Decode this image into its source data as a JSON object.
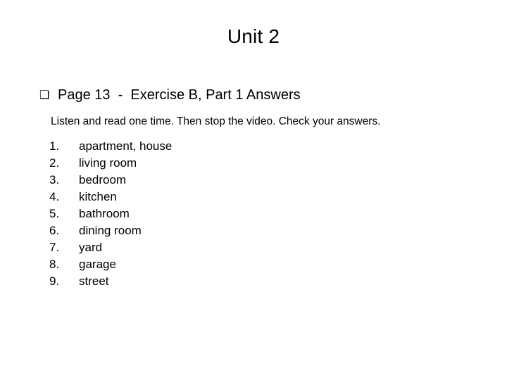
{
  "slide": {
    "title": "Unit 2",
    "heading": {
      "bullet_glyph": "❑",
      "bullet_icon_name": "square-bullet-icon",
      "text": "Page 13  -  Exercise B, Part 1 Answers"
    },
    "instruction": "Listen and read one time. Then stop the video. Check your answers.",
    "answers": [
      {
        "number": "1.",
        "text": "apartment, house"
      },
      {
        "number": "2.",
        "text": "living room"
      },
      {
        "number": "3.",
        "text": "bedroom"
      },
      {
        "number": "4.",
        "text": "kitchen"
      },
      {
        "number": "5.",
        "text": "bathroom"
      },
      {
        "number": "6.",
        "text": "dining room"
      },
      {
        "number": "7.",
        "text": "yard"
      },
      {
        "number": "8.",
        "text": "garage"
      },
      {
        "number": "9.",
        "text": "street"
      }
    ]
  },
  "colors": {
    "background": "#ffffff",
    "text": "#000000"
  }
}
